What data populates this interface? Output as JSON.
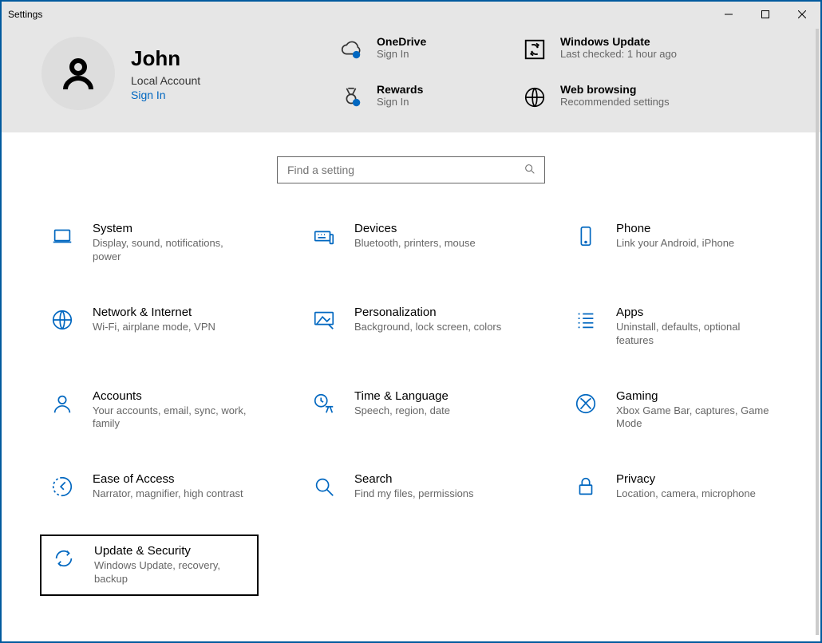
{
  "window": {
    "title": "Settings"
  },
  "user": {
    "name": "John",
    "account_type": "Local Account",
    "sign_in": "Sign In"
  },
  "status": {
    "onedrive": {
      "title": "OneDrive",
      "sub": "Sign In"
    },
    "update": {
      "title": "Windows Update",
      "sub": "Last checked: 1 hour ago"
    },
    "rewards": {
      "title": "Rewards",
      "sub": "Sign In"
    },
    "web": {
      "title": "Web browsing",
      "sub": "Recommended settings"
    }
  },
  "search": {
    "placeholder": "Find a setting"
  },
  "cats": {
    "system": {
      "title": "System",
      "sub": "Display, sound, notifications, power"
    },
    "devices": {
      "title": "Devices",
      "sub": "Bluetooth, printers, mouse"
    },
    "phone": {
      "title": "Phone",
      "sub": "Link your Android, iPhone"
    },
    "network": {
      "title": "Network & Internet",
      "sub": "Wi-Fi, airplane mode, VPN"
    },
    "personal": {
      "title": "Personalization",
      "sub": "Background, lock screen, colors"
    },
    "apps": {
      "title": "Apps",
      "sub": "Uninstall, defaults, optional features"
    },
    "accounts": {
      "title": "Accounts",
      "sub": "Your accounts, email, sync, work, family"
    },
    "time": {
      "title": "Time & Language",
      "sub": "Speech, region, date"
    },
    "gaming": {
      "title": "Gaming",
      "sub": "Xbox Game Bar, captures, Game Mode"
    },
    "ease": {
      "title": "Ease of Access",
      "sub": "Narrator, magnifier, high contrast"
    },
    "search_c": {
      "title": "Search",
      "sub": "Find my files, permissions"
    },
    "privacy": {
      "title": "Privacy",
      "sub": "Location, camera, microphone"
    },
    "update_c": {
      "title": "Update & Security",
      "sub": "Windows Update, recovery, backup"
    }
  }
}
